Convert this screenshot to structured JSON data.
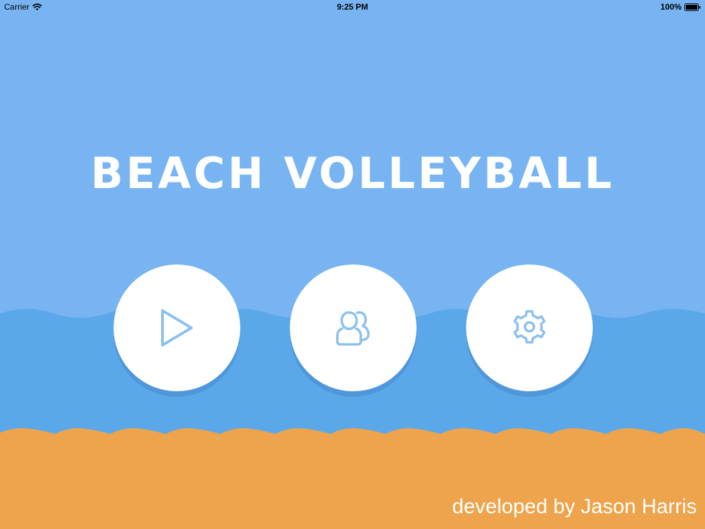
{
  "status_bar": {
    "carrier": "Carrier",
    "time": "9:25 PM",
    "battery": "100%"
  },
  "title": "Beach Volleyball",
  "menu": {
    "play_icon": "play-icon",
    "multiplayer_icon": "multiplayer-icon",
    "settings_icon": "gear-icon"
  },
  "credit": "developed by Jason Harris",
  "colors": {
    "sky": "#78b4f2",
    "sea": "#5aa8ea",
    "sand": "#eda44c",
    "icon": "#8cc0ee",
    "button": "#ffffff"
  }
}
